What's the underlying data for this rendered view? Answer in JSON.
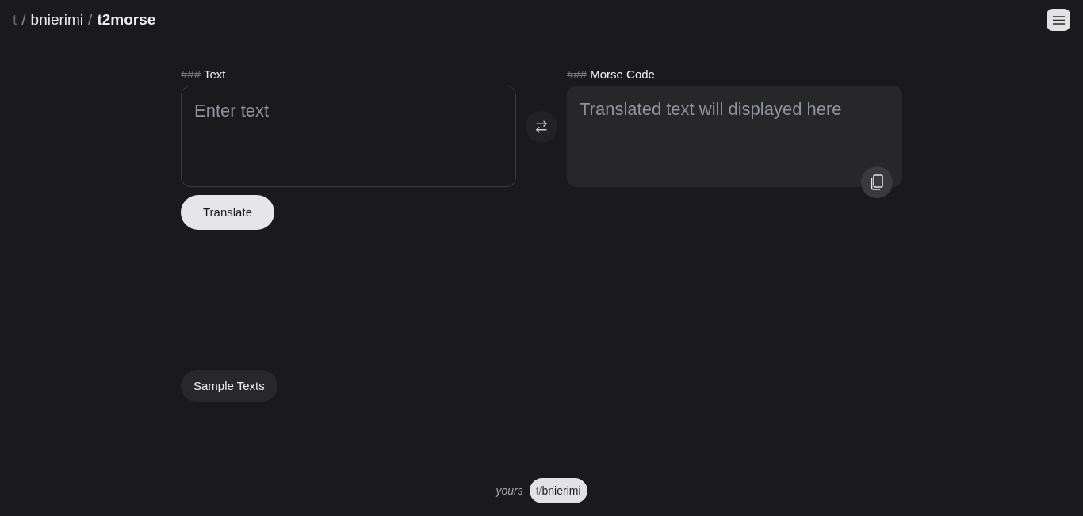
{
  "header": {
    "breadcrumb": [
      {
        "kind": "prefix",
        "text": "t"
      },
      {
        "kind": "separator",
        "text": "/"
      },
      {
        "kind": "link",
        "text": "bnierimi"
      },
      {
        "kind": "separator",
        "text": "/"
      },
      {
        "kind": "current",
        "text": "t2morse"
      }
    ]
  },
  "panels": [
    {
      "kind": "input",
      "marker": "###",
      "heading": "Text",
      "placeholder": "Enter text"
    },
    {
      "kind": "output",
      "marker": "###",
      "heading": "Morse Code",
      "placeholder": "Translated text will displayed here"
    }
  ],
  "translate_button": "Translate",
  "sample_button": "Sample Texts",
  "footer": {
    "label": "yours",
    "badge_prefix": "t/",
    "badge_user": "bnierimi"
  }
}
